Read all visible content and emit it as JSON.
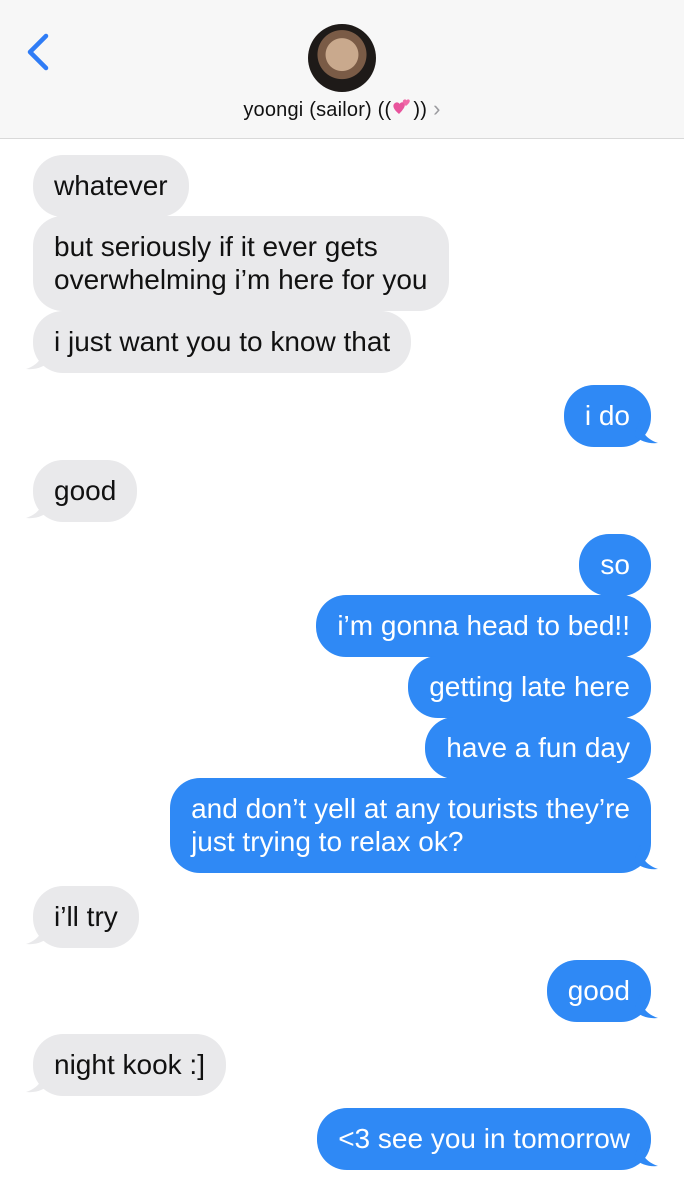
{
  "header": {
    "contact_name": "yoongi (sailor) ((",
    "contact_name_end": "))",
    "chevron": "›"
  },
  "icons": {
    "back": "chevron-left-icon",
    "avatar": "contact-avatar",
    "heart": "two-hearts-emoji"
  },
  "colors": {
    "incoming": "#e9e9eb",
    "outgoing": "#2f89f5",
    "accent": "#2f7cf6"
  },
  "messages": [
    {
      "from": "them",
      "text": "whatever"
    },
    {
      "from": "them",
      "lines": [
        "but seriously if it ever gets",
        "overwhelming i’m here for you"
      ]
    },
    {
      "from": "them",
      "text": "i just want you to know that"
    },
    {
      "from": "me",
      "text": "i do"
    },
    {
      "from": "them",
      "text": "good"
    },
    {
      "from": "me",
      "text": "so"
    },
    {
      "from": "me",
      "text": "i’m gonna head to bed!!"
    },
    {
      "from": "me",
      "text": "getting late here"
    },
    {
      "from": "me",
      "text": "have a fun day"
    },
    {
      "from": "me",
      "lines": [
        "and don’t yell at any tourists they’re",
        "just trying to relax ok?"
      ]
    },
    {
      "from": "them",
      "text": "i’ll try"
    },
    {
      "from": "me",
      "text": "good"
    },
    {
      "from": "them",
      "text": "night kook :]"
    },
    {
      "from": "me",
      "text": "<3 see you in tomorrow"
    }
  ]
}
